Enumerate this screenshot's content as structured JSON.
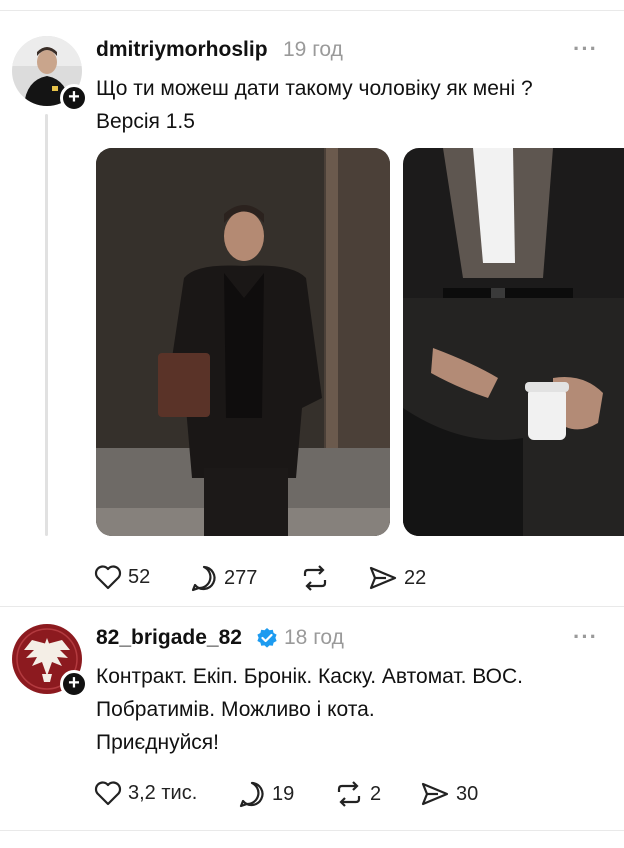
{
  "posts": [
    {
      "username": "dmitriymorhoslip",
      "time": "19 год",
      "text_lines": [
        "Що ти можеш дати такому чоловіку як мені ?",
        "Версія 1.5"
      ],
      "actions": {
        "likes": "52",
        "comments": "277",
        "reposts": "",
        "shares": "22"
      }
    },
    {
      "username": "82_brigade_82",
      "verified": true,
      "time": "18 год",
      "text_lines": [
        "Контракт. Екіп. Бронік. Каску. Автомат. ВОС.",
        "Побратимів. Можливо і кота.",
        "Приєднуйся!"
      ],
      "actions": {
        "likes": "3,2 тис.",
        "comments": "19",
        "reposts": "2",
        "shares": "30"
      }
    }
  ],
  "menu": {
    "more_glyph": "···"
  },
  "colors": {
    "verified": "#1d9bf0",
    "muted": "#9a9a9a",
    "crest_bg": "#8c1a1f"
  }
}
